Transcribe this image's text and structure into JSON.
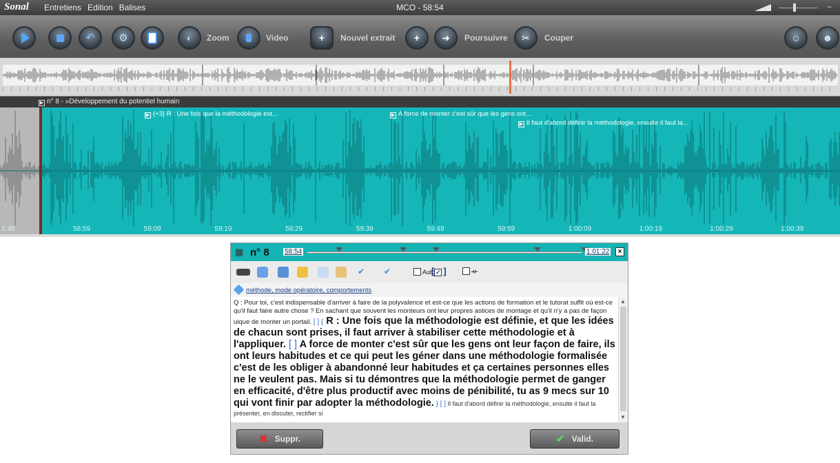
{
  "app": {
    "logo": "Sonal",
    "menu": [
      "Entretiens",
      "Edition",
      "Balises"
    ],
    "window_title": "MCO - 58:54"
  },
  "toolbar": {
    "zoom_label": "Zoom",
    "video_label": "Video",
    "new_extract_label": "Nouvel extrait",
    "continue_label": "Poursuivre",
    "cut_label": "Couper",
    "icons": [
      "play-icon",
      "stop-icon",
      "rewind-icon",
      "settings-icon",
      "document-icon",
      "zoom-icon",
      "video-icon",
      "new-extract-icon",
      "add-extract-icon",
      "continue-icon",
      "cut-icon",
      "users-icon",
      "user-icon"
    ]
  },
  "episode": {
    "label": "n° 8 - »Développement du potentiel humain"
  },
  "waveform": {
    "segments": [
      "{+3}  R : Une fois que la méthodologie est...",
      "A force de monter c'est sûr que les gens ont...",
      "Il faut d'abord définir la méthodologie, ensuite il faut la..."
    ],
    "left_time": "1:49",
    "times": [
      "58:59",
      "59:09",
      "59:19",
      "59:29",
      "59:39",
      "59:49",
      "59:59",
      "1:00:09",
      "1:00:19",
      "1:00:29",
      "1:00:39"
    ],
    "color": "#15b6b8"
  },
  "dialog": {
    "number": "n° 8",
    "start_time": "58:54",
    "end_time": "1:01:22",
    "close_label": "×",
    "auto_label": "Auto",
    "tags": "méthode, mode opératoire, comportements",
    "question": "Q : Pour toi, c'est indispensable d'arriver à faire de la polyvalence et est-ce que les actions de formation et le tutorat suffit où est-ce qu'il faut faire autre chose ? En sachant que souvent les monteurs ont leur propres astices de montage et qu'il n'y a pas de façon uique de monter un portail.",
    "bracket_1": " [ ] {",
    "answer_1": " R : Une fois que la méthodologie est définie, et que les idées de chacun sont prises, il faut arriver à stabiliser cette méthodologie et à l'appliquer.",
    "bracket_2": " [ ]",
    "answer_2": " A force de monter c'est sûr que les gens ont leur façon de faire, ils ont leurs habitudes et ce qui peut les géner dans une méthodologie formalisée c'est de les obliger à abandonné leur habitudes et ça certaines personnes elles ne le veulent pas. Mais si tu démontres que la méthodologie permet de ganger en efficacité, d'être plus productif avec moins de pénibilité, tu as 9 mecs sur 10 qui vont finir par adopter la méthodologie.",
    "bracket_3": " } [ ]",
    "answer_3": " Il faut d'abord définir la méthodologie, ensuite il faut la présenter, en discuter, rectifier si",
    "delete_label": "Suppr.",
    "validate_label": "Valid."
  }
}
